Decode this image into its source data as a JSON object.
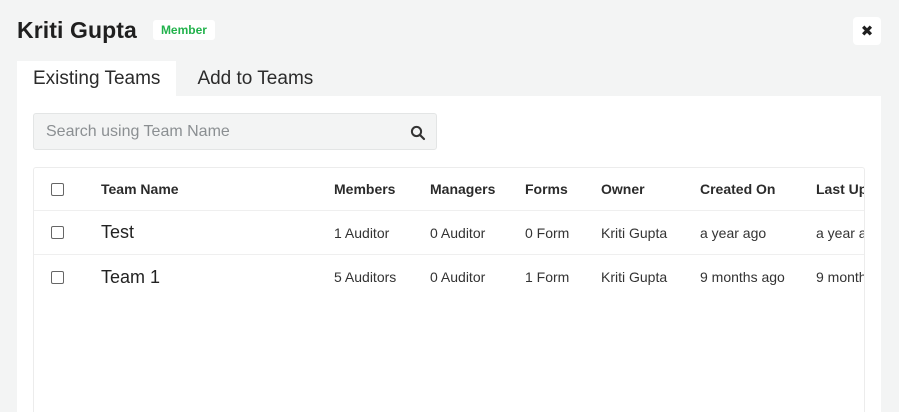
{
  "header": {
    "title": "Kriti Gupta",
    "badge": "Member",
    "close_icon": "close-icon"
  },
  "tabs": [
    {
      "label": "Existing Teams",
      "active": true
    },
    {
      "label": "Add to Teams",
      "active": false
    }
  ],
  "search": {
    "placeholder": "Search using Team Name",
    "value": "",
    "icon": "search-icon"
  },
  "table": {
    "columns": [
      "Team Name",
      "Members",
      "Managers",
      "Forms",
      "Owner",
      "Created On",
      "Last Up"
    ],
    "rows": [
      {
        "name": "Test",
        "members": "1 Auditor",
        "managers": "0 Auditor",
        "forms": "0 Form",
        "owner": "Kriti Gupta",
        "created": "a year ago",
        "updated": "a year a"
      },
      {
        "name": "Team 1",
        "members": "5 Auditors",
        "managers": "0 Auditor",
        "forms": "1 Form",
        "owner": "Kriti Gupta",
        "created": "9 months ago",
        "updated": "9 month"
      }
    ]
  },
  "colors": {
    "background": "#f3f4f4",
    "badge_text": "#22b24c",
    "panel": "#ffffff"
  }
}
